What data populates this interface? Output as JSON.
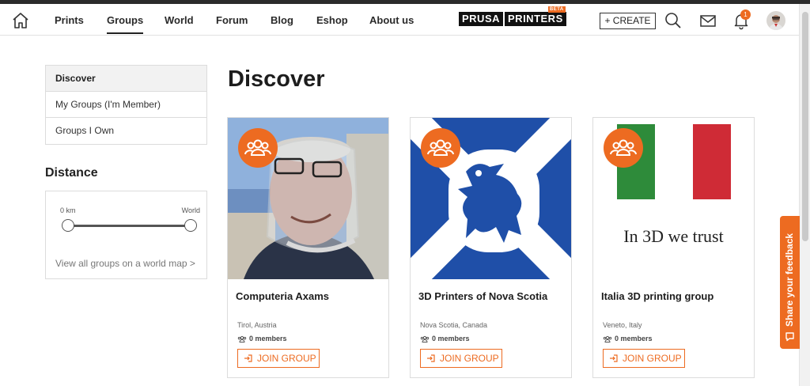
{
  "nav": {
    "items": [
      {
        "label": "Prints"
      },
      {
        "label": "Groups",
        "active": true
      },
      {
        "label": "World"
      },
      {
        "label": "Forum"
      },
      {
        "label": "Blog"
      },
      {
        "label": "Eshop"
      },
      {
        "label": "About us"
      }
    ],
    "logo_part1": "PRUSA",
    "logo_part2": "PRINTERS",
    "logo_badge": "BETA",
    "create_label": "+ CREATE",
    "notification_count": "1",
    "icons": [
      "home-icon",
      "search-icon",
      "mail-icon",
      "bell-icon",
      "avatar"
    ]
  },
  "sidebar": {
    "items": [
      {
        "label": "Discover",
        "active": true
      },
      {
        "label": "My Groups (I'm Member)"
      },
      {
        "label": "Groups I Own"
      }
    ],
    "distance_title": "Distance",
    "distance_min": "0 km",
    "distance_max": "World",
    "map_link": "View all groups on a world map >"
  },
  "main": {
    "title": "Discover",
    "cards": [
      {
        "title": "Computeria Axams",
        "location": "Tirol, Austria",
        "members": "0 members",
        "join_label": "JOIN GROUP"
      },
      {
        "title": "3D Printers of Nova Scotia",
        "location": "Nova Scotia, Canada",
        "members": "0 members",
        "join_label": "JOIN GROUP"
      },
      {
        "title": "Italia 3D printing group",
        "location": "Veneto, Italy",
        "members": "0 members",
        "join_label": "JOIN GROUP",
        "image_text": "In 3D we trust"
      }
    ]
  },
  "feedback_label": "Share your feedback",
  "colors": {
    "accent": "#ed6b21",
    "nova_blue": "#1f4fa8",
    "italy_green": "#2e8b3a",
    "italy_red": "#cf2b36"
  }
}
